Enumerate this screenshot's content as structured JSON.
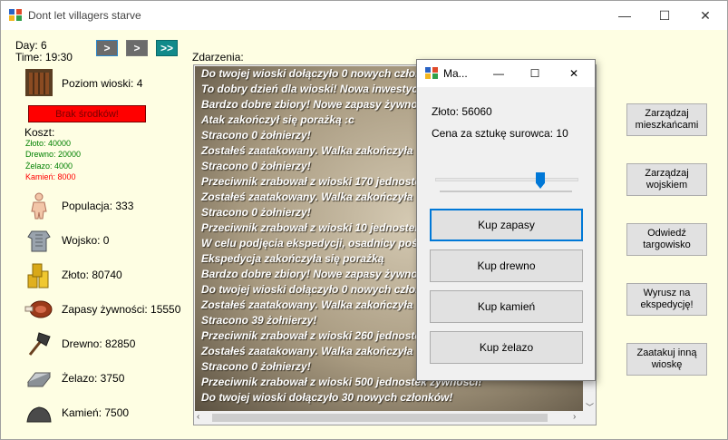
{
  "window": {
    "title": "Dont let villagers starve",
    "minimize": "—",
    "maximize": "☐",
    "close": "✕"
  },
  "time": {
    "day": "Day: 6",
    "time": "Time: 19:30"
  },
  "nav_buttons": [
    ">",
    ">",
    ">>"
  ],
  "village": {
    "level": "Poziom wioski: 4",
    "warning": "Brak środków!",
    "cost_title": "Koszt:",
    "cost_gold": "Złoto: 40000",
    "cost_wood": "Drewno: 20000",
    "cost_iron": "Żelazo: 4000",
    "cost_stone": "Kamień: 8000"
  },
  "stats": {
    "population": "Populacja: 333",
    "army": "Wojsko: 0",
    "gold": "Złoto: 80740",
    "food": "Zapasy żywności: 15550",
    "wood": "Drewno: 82850",
    "iron": "Żelazo: 3750",
    "stone": "Kamień: 7500"
  },
  "events": {
    "label": "Zdarzenia:",
    "lines": [
      "Do twojej wioski dołączyło 0 nowych członków!",
      "To dobry dzień dla wioski! Nowa inwestycja!",
      "Bardzo dobre zbiory! Nowe zapasy żywności!",
      "Atak zakończył się porażką :c",
      "Stracono 0 żołnierzy!",
      "Zostałeś zaatakowany. Walka zakończyła się",
      "Stracono 0 żołnierzy!",
      "Przeciwnik zrabował z wioski 170 jednostek",
      "Zostałeś zaatakowany. Walka zakończyła się",
      "Stracono 0 żołnierzy!",
      "Przeciwnik zrabował z wioski 10 jednostek",
      "W celu podjęcia ekspedycji, osadnicy pośw",
      "Ekspedycja zakończyła się porażką",
      "Bardzo dobre zbiory! Nowe zapasy żywności!",
      "Do twojej wioski dołączyło 0 nowych człon",
      "Zostałeś zaatakowany. Walka zakończyła się",
      "Stracono 39 żołnierzy!",
      "Przeciwnik zrabował z wioski 260 jednostek",
      "Zostałeś zaatakowany. Walka zakończyła się",
      "Stracono 0 żołnierzy!",
      "Przeciwnik zrabował z wioski 500 jednostek żywności!",
      "Do twojej wioski dołączyło 30 nowych członków!"
    ]
  },
  "actions": [
    "Zarządzaj mieszkańcami",
    "Zarządzaj wojskiem",
    "Odwiedź targowisko",
    "Wyrusz na ekspedycję!",
    "Zaatakuj inną wioskę"
  ],
  "market": {
    "title": "Ma...",
    "gold": "Złoto: 56060",
    "price": "Cena za sztukę surowca: 10",
    "slider_level": 0.75,
    "buy_food": "Kup zapasy",
    "buy_wood": "Kup drewno",
    "buy_stone": "Kup kamień",
    "buy_iron": "Kup żelazo"
  },
  "colors": {
    "background": "#fefee3",
    "warning": "#ff0000",
    "cost_ok": "#008000",
    "cost_missing": "#ff0000",
    "accent": "#0078d7"
  }
}
